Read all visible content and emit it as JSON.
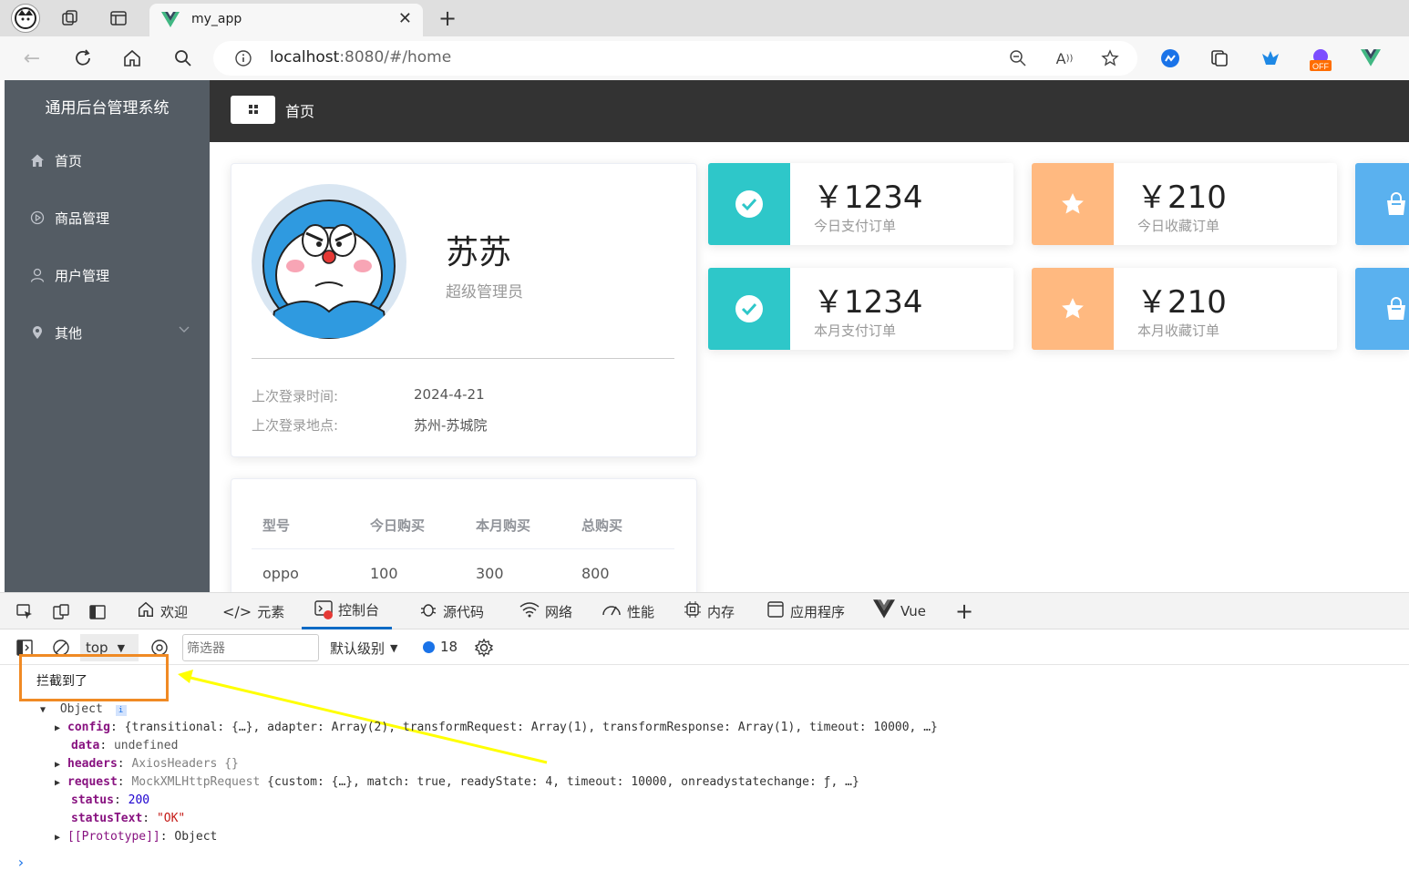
{
  "browser": {
    "tab_title": "my_app",
    "url_host": "localhost",
    "url_path": ":8080/#/home"
  },
  "app": {
    "sidebar": {
      "title": "通用后台管理系统",
      "items": [
        {
          "label": "首页",
          "icon": "home-icon"
        },
        {
          "label": "商品管理",
          "icon": "play-circle-icon"
        },
        {
          "label": "用户管理",
          "icon": "user-icon"
        },
        {
          "label": "其他",
          "icon": "location-icon"
        }
      ]
    },
    "header": {
      "breadcrumb": "首页"
    },
    "user": {
      "name": "苏苏",
      "role": "超级管理员",
      "last_login_time_label": "上次登录时间:",
      "last_login_time": "2024-4-21",
      "last_login_place_label": "上次登录地点:",
      "last_login_place": "苏州-苏城院"
    },
    "stats": [
      {
        "value": "￥1234",
        "label": "今日支付订单",
        "color": "#2ec7c9",
        "icon": "check-circle-icon"
      },
      {
        "value": "￥210",
        "label": "今日收藏订单",
        "color": "#ffb980",
        "icon": "star-icon"
      },
      {
        "value": "",
        "label": "",
        "color": "#5ab1ef",
        "icon": "bag-icon"
      },
      {
        "value": "￥1234",
        "label": "本月支付订单",
        "color": "#2ec7c9",
        "icon": "check-circle-icon"
      },
      {
        "value": "￥210",
        "label": "本月收藏订单",
        "color": "#ffb980",
        "icon": "star-icon"
      },
      {
        "value": "",
        "label": "",
        "color": "#5ab1ef",
        "icon": "bag-icon"
      }
    ],
    "table": {
      "headers": [
        "型号",
        "今日购买",
        "本月购买",
        "总购买"
      ],
      "rows": [
        [
          "oppo",
          "100",
          "300",
          "800"
        ]
      ]
    }
  },
  "devtools": {
    "tabs": [
      "欢迎",
      "元素",
      "控制台",
      "源代码",
      "网络",
      "性能",
      "内存",
      "应用程序",
      "Vue"
    ],
    "context": "top",
    "filter_placeholder": "筛选器",
    "level": "默认级别",
    "message_count": "18",
    "console": {
      "log_text": "拦截到了",
      "object_label": "Object",
      "config_line": "{transitional: {…}, adapter: Array(2), transformRequest: Array(1), transformResponse: Array(1), timeout: 10000,  …}",
      "data_value": "undefined",
      "headers_value": "AxiosHeaders  {}",
      "request_type": "MockXMLHttpRequest",
      "request_line": "{custom: {…}, match: true, readyState: 4, timeout: 10000, onreadystatechange: ƒ,  …}",
      "status_value": "200",
      "statusText_value": "\"OK\"",
      "prototype_value": "Object"
    }
  }
}
